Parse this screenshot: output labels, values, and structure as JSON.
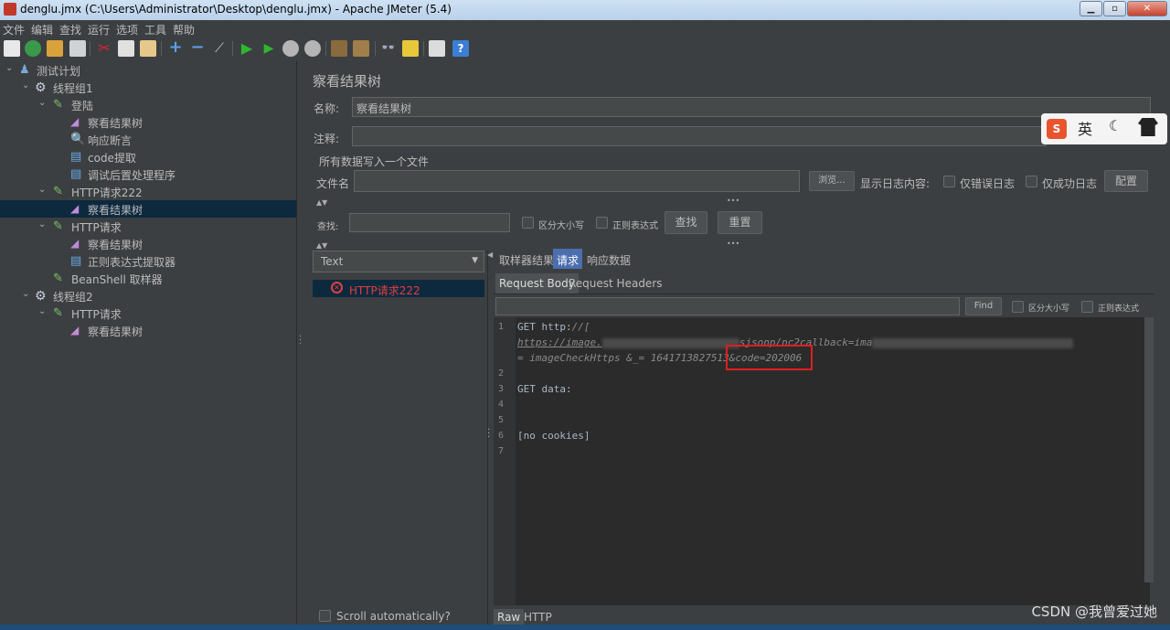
{
  "window": {
    "title": "denglu.jmx (C:\\Users\\Administrator\\Desktop\\denglu.jmx) - Apache JMeter (5.4)",
    "minimize": "▁",
    "maximize": "▫",
    "close": "✕"
  },
  "menu": [
    "文件",
    "编辑",
    "查找",
    "运行",
    "选项",
    "工具",
    "帮助"
  ],
  "tree": [
    {
      "label": "测试计划",
      "icon": "test-plan-icon"
    },
    {
      "label": "线程组1",
      "icon": "gear-icon"
    },
    {
      "label": "登陆",
      "icon": "sampler-pen-icon"
    },
    {
      "label": "察看结果树",
      "icon": "results-tree-icon"
    },
    {
      "label": "响应断言",
      "icon": "assertion-icon"
    },
    {
      "label": "code提取",
      "icon": "extractor-icon"
    },
    {
      "label": "调试后置处理程序",
      "icon": "postprocessor-icon"
    },
    {
      "label": "HTTP请求222",
      "icon": "sampler-pen-icon"
    },
    {
      "label": "察看结果树",
      "icon": "results-tree-icon"
    },
    {
      "label": "HTTP请求",
      "icon": "sampler-pen-icon"
    },
    {
      "label": "察看结果树",
      "icon": "results-tree-icon"
    },
    {
      "label": "正则表达式提取器",
      "icon": "extractor-icon"
    },
    {
      "label": "BeanShell 取样器",
      "icon": "sampler-pen-icon"
    },
    {
      "label": "线程组2",
      "icon": "gear-icon"
    },
    {
      "label": "HTTP请求",
      "icon": "sampler-pen-icon"
    },
    {
      "label": "察看结果树",
      "icon": "results-tree-icon"
    }
  ],
  "panel": {
    "title": "察看结果树",
    "name_label": "名称:",
    "name_value": "察看结果树",
    "comment_label": "注释:",
    "comment_value": "",
    "write_all_label": "所有数据写入一个文件",
    "filename_label": "文件名",
    "filename_value": "",
    "browse_button": "浏览...",
    "log_content_label": "显示日志内容:",
    "errors_only": "仅错误日志",
    "success_only": "仅成功日志",
    "configure_button": "配置",
    "search_label": "查找:",
    "case_sensitive": "区分大小写",
    "regex": "正则表达式",
    "find_button": "查找",
    "reset_button": "重置",
    "view_mode": "Text",
    "result_item": "HTTP请求222",
    "scroll_auto": "Scroll automatically?"
  },
  "tabs": [
    "取样器结果",
    "请求",
    "响应数据"
  ],
  "subtabs": [
    "Request Body",
    "Request Headers"
  ],
  "editor_search": {
    "find": "Find",
    "case_sensitive": "区分大小写",
    "regex": "正则表达式"
  },
  "editor": {
    "line_numbers": [
      "1",
      "2",
      "3",
      "4",
      "5",
      "6",
      "7"
    ],
    "line1a": "GET http:",
    "line1b": "//[",
    "line1c_pre": "https://image.",
    "line1c_mid": "sjsonp/nc2callback=ima",
    "line1c_end": "",
    "line1d": "= imageCheckHttps &_= 1641713827513&code=202006",
    "line3": "GET data:",
    "line6": "[no cookies]"
  },
  "bottom_tabs": [
    "Raw",
    "HTTP"
  ],
  "ime_buttons": [
    "英"
  ],
  "watermark": "CSDN @我曾爱过她",
  "colors": {
    "background": "#3c3f41",
    "selection": "#0d293e",
    "active_tab": "#4b6eaf",
    "highlight_box": "#e01d1d",
    "error_text": "#e04040"
  }
}
